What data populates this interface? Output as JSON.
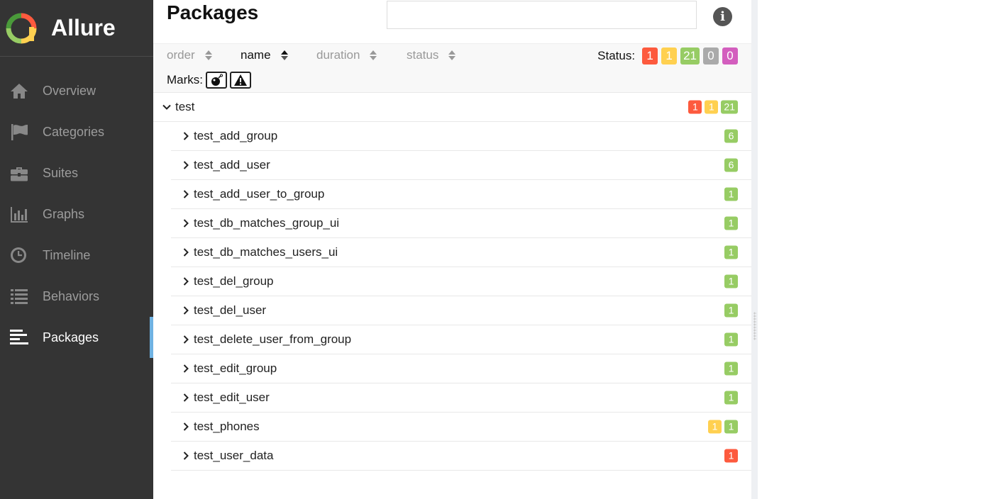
{
  "app": {
    "name": "Allure"
  },
  "nav": [
    {
      "label": "Overview",
      "icon": "home-icon",
      "active": false
    },
    {
      "label": "Categories",
      "icon": "flag-icon",
      "active": false
    },
    {
      "label": "Suites",
      "icon": "briefcase-icon",
      "active": false
    },
    {
      "label": "Graphs",
      "icon": "bar-chart-icon",
      "active": false
    },
    {
      "label": "Timeline",
      "icon": "clock-icon",
      "active": false
    },
    {
      "label": "Behaviors",
      "icon": "list-icon",
      "active": false
    },
    {
      "label": "Packages",
      "icon": "align-left-icon",
      "active": true
    }
  ],
  "header": {
    "title": "Packages",
    "search_value": "",
    "info_icon": "info-icon"
  },
  "toolbar": {
    "sort": [
      {
        "label": "order",
        "active": false
      },
      {
        "label": "name",
        "active": true
      },
      {
        "label": "duration",
        "active": false
      },
      {
        "label": "status",
        "active": false
      }
    ],
    "status_label": "Status:",
    "status_counts": [
      {
        "value": "1",
        "status": "failed",
        "color": "#fd5a3e"
      },
      {
        "value": "1",
        "status": "broken",
        "color": "#ffd050"
      },
      {
        "value": "21",
        "status": "passed",
        "color": "#97cc64"
      },
      {
        "value": "0",
        "status": "skipped",
        "color": "#aaaaaa"
      },
      {
        "value": "0",
        "status": "unknown",
        "color": "#d35ebe"
      }
    ],
    "marks_label": "Marks:",
    "marks": [
      "flaky-bomb-icon",
      "warning-icon"
    ]
  },
  "tree": {
    "root": {
      "name": "test",
      "expanded": true,
      "badges": [
        {
          "value": "1",
          "status": "failed"
        },
        {
          "value": "1",
          "status": "broken"
        },
        {
          "value": "21",
          "status": "passed"
        }
      ]
    },
    "children": [
      {
        "name": "test_add_group",
        "badges": [
          {
            "value": "6",
            "status": "passed"
          }
        ]
      },
      {
        "name": "test_add_user",
        "badges": [
          {
            "value": "6",
            "status": "passed"
          }
        ]
      },
      {
        "name": "test_add_user_to_group",
        "badges": [
          {
            "value": "1",
            "status": "passed"
          }
        ]
      },
      {
        "name": "test_db_matches_group_ui",
        "badges": [
          {
            "value": "1",
            "status": "passed"
          }
        ]
      },
      {
        "name": "test_db_matches_users_ui",
        "badges": [
          {
            "value": "1",
            "status": "passed"
          }
        ]
      },
      {
        "name": "test_del_group",
        "badges": [
          {
            "value": "1",
            "status": "passed"
          }
        ]
      },
      {
        "name": "test_del_user",
        "badges": [
          {
            "value": "1",
            "status": "passed"
          }
        ]
      },
      {
        "name": "test_delete_user_from_group",
        "badges": [
          {
            "value": "1",
            "status": "passed"
          }
        ]
      },
      {
        "name": "test_edit_group",
        "badges": [
          {
            "value": "1",
            "status": "passed"
          }
        ]
      },
      {
        "name": "test_edit_user",
        "badges": [
          {
            "value": "1",
            "status": "passed"
          }
        ]
      },
      {
        "name": "test_phones",
        "badges": [
          {
            "value": "1",
            "status": "broken"
          },
          {
            "value": "1",
            "status": "passed"
          }
        ]
      },
      {
        "name": "test_user_data",
        "badges": [
          {
            "value": "1",
            "status": "failed"
          }
        ]
      }
    ]
  },
  "colors": {
    "failed": "#fd5a3e",
    "broken": "#ffd050",
    "passed": "#97cc64",
    "skipped": "#aaaaaa",
    "unknown": "#d35ebe",
    "sidebar_bg": "#343434",
    "accent": "#6fb2e2"
  }
}
